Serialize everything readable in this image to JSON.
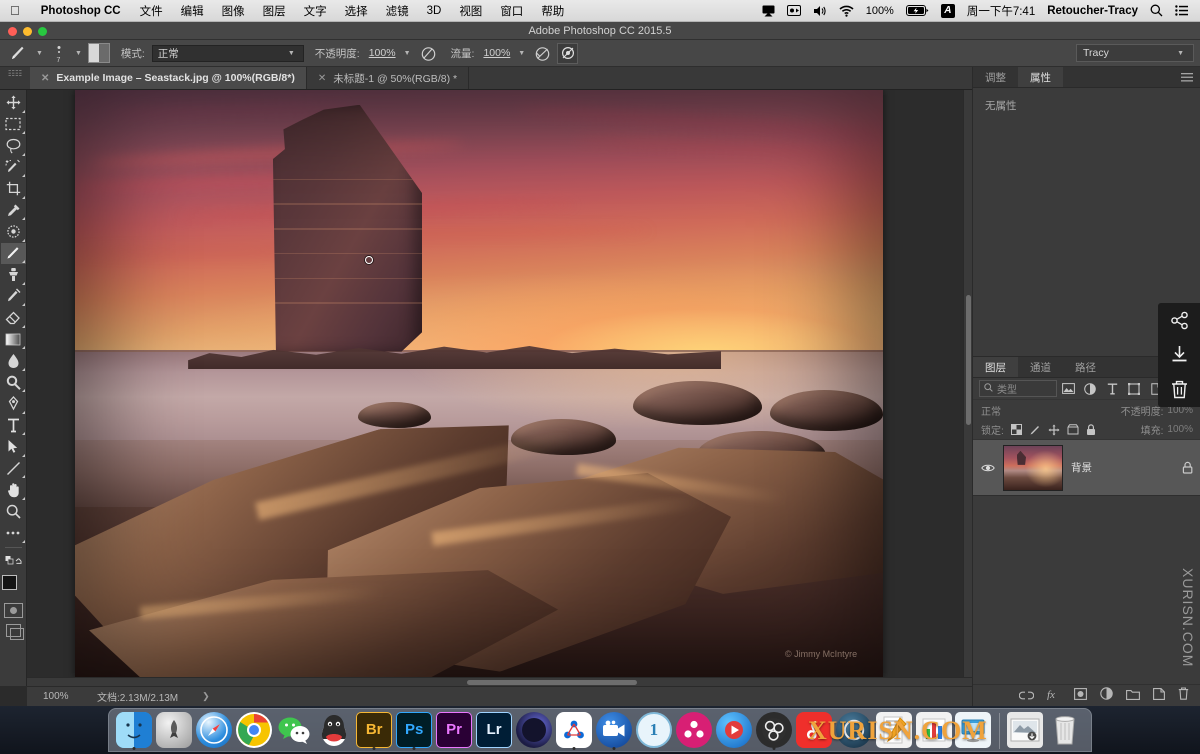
{
  "macbar": {
    "apple_icon": "apple-icon",
    "app_name": "Photoshop CC",
    "menus": [
      "文件",
      "编辑",
      "图像",
      "图层",
      "文字",
      "选择",
      "滤镜",
      "3D",
      "视图",
      "窗口",
      "帮助"
    ],
    "status_icons": [
      "airplay-icon",
      "screen-record-icon",
      "volume-icon",
      "wifi-icon"
    ],
    "battery_percent": "100%",
    "input_source": "A",
    "time": "周一下午7:41",
    "user": "Retoucher-Tracy",
    "search_icon": "search-icon",
    "control_center_icon": "list-icon"
  },
  "window": {
    "title": "Adobe Photoshop CC 2015.5",
    "traffic_lights": [
      "close-button",
      "minimize-button",
      "zoom-button"
    ],
    "colors": {
      "close": "#ff5f57",
      "minimize": "#febc2e",
      "zoom": "#28c840"
    }
  },
  "options_bar": {
    "tool_icon": "brush-icon",
    "brush_preset_icon": "brush-preset-icon",
    "toggle_panel_icon": "brush-panel-icon",
    "mode_label": "模式:",
    "mode_value": "正常",
    "opacity_label": "不透明度:",
    "opacity_value": "100%",
    "pressure_opacity_icon": "pressure-opacity-icon",
    "flow_label": "流量:",
    "flow_value": "100%",
    "airbrush_icon": "airbrush-icon",
    "smoothing_icon": "smoothing-icon",
    "workspace": "Tracy",
    "workspace_caret": "chevron-down-icon"
  },
  "tabs": [
    {
      "label": "Example Image – Seastack.jpg @ 100%(RGB/8*)",
      "active": true,
      "close_icon": "close-icon"
    },
    {
      "label": "未标题-1 @ 50%(RGB/8) *",
      "active": false,
      "close_icon": "close-icon"
    }
  ],
  "toolbar": {
    "tools": [
      {
        "name": "move-tool",
        "has_submenu": true,
        "active": false
      },
      {
        "name": "rectangular-marquee-tool",
        "has_submenu": true,
        "active": false
      },
      {
        "name": "lasso-tool",
        "has_submenu": true,
        "active": false
      },
      {
        "name": "quick-selection-tool",
        "has_submenu": true,
        "active": false
      },
      {
        "name": "crop-tool",
        "has_submenu": true,
        "active": false
      },
      {
        "name": "eyedropper-tool",
        "has_submenu": true,
        "active": false
      },
      {
        "name": "spot-healing-brush-tool",
        "has_submenu": true,
        "active": false
      },
      {
        "name": "brush-tool",
        "has_submenu": true,
        "active": true
      },
      {
        "name": "clone-stamp-tool",
        "has_submenu": true,
        "active": false
      },
      {
        "name": "history-brush-tool",
        "has_submenu": true,
        "active": false
      },
      {
        "name": "eraser-tool",
        "has_submenu": true,
        "active": false
      },
      {
        "name": "gradient-tool",
        "has_submenu": true,
        "active": false
      },
      {
        "name": "blur-tool",
        "has_submenu": true,
        "active": false
      },
      {
        "name": "dodge-tool",
        "has_submenu": true,
        "active": false
      },
      {
        "name": "pen-tool",
        "has_submenu": true,
        "active": false
      },
      {
        "name": "type-tool",
        "has_submenu": true,
        "active": false
      },
      {
        "name": "path-selection-tool",
        "has_submenu": true,
        "active": false
      },
      {
        "name": "line-tool",
        "has_submenu": true,
        "active": false
      },
      {
        "name": "hand-tool",
        "has_submenu": true,
        "active": false
      },
      {
        "name": "zoom-tool",
        "has_submenu": false,
        "active": false
      },
      {
        "name": "edit-toolbar-tool",
        "has_submenu": true,
        "active": false
      }
    ],
    "foreground_color": "#141414",
    "background_color": "#b45050",
    "swap_colors_icon": "swap-colors-icon",
    "default_colors_icon": "default-colors-icon",
    "quick_mask_icon": "quick-mask-icon",
    "screen_mode_icon": "screen-mode-icon"
  },
  "canvas": {
    "document_title": "Example Image – Seastack.jpg",
    "photo_credit": "© Jimmy McIntyre",
    "brush_cursor": "brush-cursor",
    "scrollbar_vertical": "canvas-scrollbar-vertical",
    "scrollbar_horizontal": "canvas-scrollbar-horizontal"
  },
  "status_bar": {
    "zoom": "100%",
    "doc_size": "文档:2.13M/2.13M",
    "expand_icon": "chevron-right-icon"
  },
  "properties_panel": {
    "tabs": [
      {
        "label": "调整",
        "active": false
      },
      {
        "label": "属性",
        "active": true
      }
    ],
    "menu_icon": "panel-menu-icon",
    "empty_text": "无属性"
  },
  "layers_panel": {
    "tabs": [
      {
        "label": "图层",
        "active": true
      },
      {
        "label": "通道",
        "active": false
      },
      {
        "label": "路径",
        "active": false
      }
    ],
    "menu_icon": "panel-menu-icon",
    "filter": {
      "search_icon": "search-icon",
      "placeholder": "类型",
      "filter_icons": [
        "pixel-filter-icon",
        "adjustment-filter-icon",
        "type-filter-icon",
        "shape-filter-icon",
        "smart-object-filter-icon"
      ],
      "toggle_icon": "filter-toggle-icon"
    },
    "blend_mode": "正常",
    "opacity_label": "不透明度:",
    "opacity_value": "100%",
    "lock_label": "锁定:",
    "lock_icons": [
      "lock-transparent-icon",
      "lock-image-icon",
      "lock-position-icon",
      "lock-artboard-icon",
      "lock-all-icon"
    ],
    "fill_label": "填充:",
    "fill_value": "100%",
    "layers": [
      {
        "name": "背景",
        "visible": true,
        "locked": true,
        "visibility_icon": "eye-icon",
        "lock_icon": "lock-icon",
        "thumbnail": "layer-thumbnail"
      }
    ],
    "footer_icons": [
      "link-layers-icon",
      "layer-style-fx-icon",
      "add-mask-icon",
      "new-adjustment-layer-icon",
      "new-group-icon",
      "new-layer-icon",
      "delete-layer-icon"
    ]
  },
  "edge_overlay": {
    "icons": [
      "share-icon",
      "download-icon",
      "trash-icon"
    ]
  },
  "watermarks": {
    "side": "XURISN.COM",
    "dock": "XURISN.COM"
  },
  "dock": {
    "items": [
      {
        "name": "finder",
        "label": "",
        "running": true,
        "color1": "#2d9fe8",
        "color2": "#1a6fc4"
      },
      {
        "name": "launchpad",
        "label": "",
        "running": false,
        "color1": "#d6d6d6",
        "color2": "#9a9a9a"
      },
      {
        "name": "safari",
        "label": "",
        "running": false,
        "color1": "#3ba7f0",
        "color2": "#1c6fc0"
      },
      {
        "name": "chrome",
        "label": "",
        "running": false,
        "color1": "#f2c300",
        "color2": "#34a853"
      },
      {
        "name": "wechat",
        "label": "",
        "running": false,
        "color1": "#5fd66b",
        "color2": "#2aa63a"
      },
      {
        "name": "qq",
        "label": "",
        "running": false,
        "color1": "#2e2e2e",
        "color2": "#d03030"
      },
      {
        "name": "bridge",
        "label": "Br",
        "running": true,
        "color1": "#3a2a06",
        "color2": "#f7b733"
      },
      {
        "name": "photoshop",
        "label": "Ps",
        "running": true,
        "color1": "#001d26",
        "color2": "#31a8ff"
      },
      {
        "name": "premiere",
        "label": "Pr",
        "running": false,
        "color1": "#2a0035",
        "color2": "#ea77ff"
      },
      {
        "name": "lightroom",
        "label": "Lr",
        "running": false,
        "color1": "#001e36",
        "color2": "#cfe7ff"
      },
      {
        "name": "cinema4d",
        "label": "",
        "running": false,
        "color1": "#3b3f8c",
        "color2": "#14142e"
      },
      {
        "name": "blue-app",
        "label": "",
        "running": true,
        "color1": "#ffffff",
        "color2": "#0c6bd8"
      },
      {
        "name": "camtasia",
        "label": "",
        "running": true,
        "color1": "#1356c4",
        "color2": "#0b3b8c"
      },
      {
        "name": "one-app",
        "label": "1",
        "running": false,
        "color1": "#d7ecf7",
        "color2": "#2a7fb5"
      },
      {
        "name": "davinci-resolve",
        "label": "",
        "running": false,
        "color1": "#e0217d",
        "color2": "#b8155f"
      },
      {
        "name": "potplayer",
        "label": "",
        "running": false,
        "color1": "#2fa8ef",
        "color2": "#1464c0"
      },
      {
        "name": "obs-studio",
        "label": "",
        "running": true,
        "color1": "#3a3a3a",
        "color2": "#151515"
      },
      {
        "name": "netease-music",
        "label": "",
        "running": false,
        "color1": "#f0312d",
        "color2": "#c41d1a"
      },
      {
        "name": "qq-browser",
        "label": "",
        "running": false,
        "color1": "#2c5a7a",
        "color2": "#12283a"
      },
      {
        "name": "pages",
        "label": "",
        "running": false,
        "color1": "#f7a81b",
        "color2": "#e0e0e0"
      },
      {
        "name": "numbers",
        "label": "",
        "running": false,
        "color1": "#2fbf3f",
        "color2": "#e8e8e8"
      },
      {
        "name": "keynote",
        "label": "",
        "running": false,
        "color1": "#3aa0dd",
        "color2": "#e6e6e6"
      }
    ],
    "trailing_items": [
      {
        "name": "downloads-stack",
        "label": "",
        "color1": "#d9d9d9",
        "color2": "#9c9c9c"
      },
      {
        "name": "trash",
        "label": "",
        "color1": "#e6e6e6",
        "color2": "#b5b5b5"
      }
    ]
  }
}
